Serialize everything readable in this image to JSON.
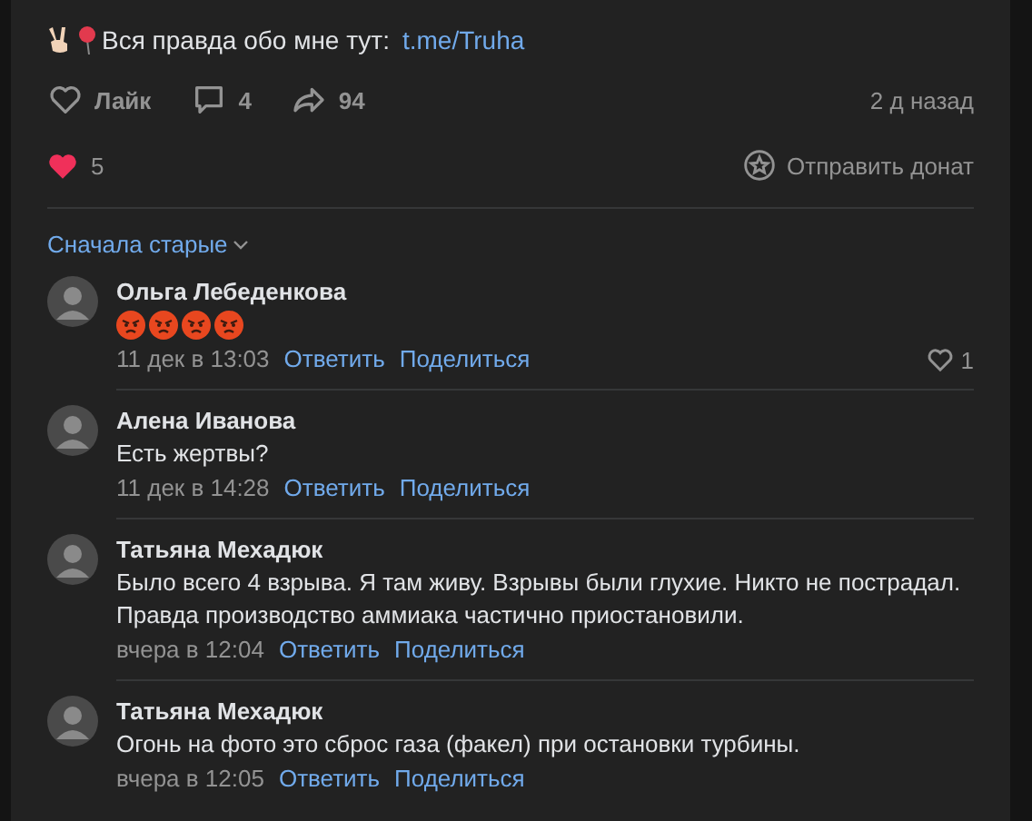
{
  "post": {
    "emojis": [
      {
        "kind": "victory-hand"
      },
      {
        "kind": "pin"
      }
    ],
    "text": "Вся правда обо мне тут:",
    "link": "t.me/Truha",
    "actions": [
      {
        "kind": "like",
        "label": "Лайк"
      },
      {
        "kind": "comment",
        "label": "4"
      },
      {
        "kind": "share",
        "label": "94"
      }
    ],
    "time": "2 д назад",
    "reaction_count": "5",
    "donate": "Отправить донат"
  },
  "sort": "Сначала старые",
  "comments": [
    {
      "author": "Ольга Лебеденкова",
      "emojis": [
        {
          "kind": "angry"
        },
        {
          "kind": "angry"
        },
        {
          "kind": "angry"
        },
        {
          "kind": "angry"
        }
      ],
      "time": "11 дек в 13:03",
      "reply": "Ответить",
      "share": "Поделиться",
      "likes": "1"
    },
    {
      "author": "Алена Иванова",
      "text": "Есть жертвы?",
      "time": "11 дек в 14:28",
      "reply": "Ответить",
      "share": "Поделиться"
    },
    {
      "author": "Татьяна Мехадюк",
      "text": "Было всего 4 взрыва. Я там живу. Взрывы были глухие. Никто не пострадал. Правда производство аммиака частично приостановили.",
      "time": "вчера в 12:04",
      "reply": "Ответить",
      "share": "Поделиться"
    },
    {
      "author": "Татьяна Мехадюк",
      "text": "Огонь на фото это сброс газа (факел) при остановки турбины.",
      "time": "вчера в 12:05",
      "reply": "Ответить",
      "share": "Поделиться"
    }
  ]
}
